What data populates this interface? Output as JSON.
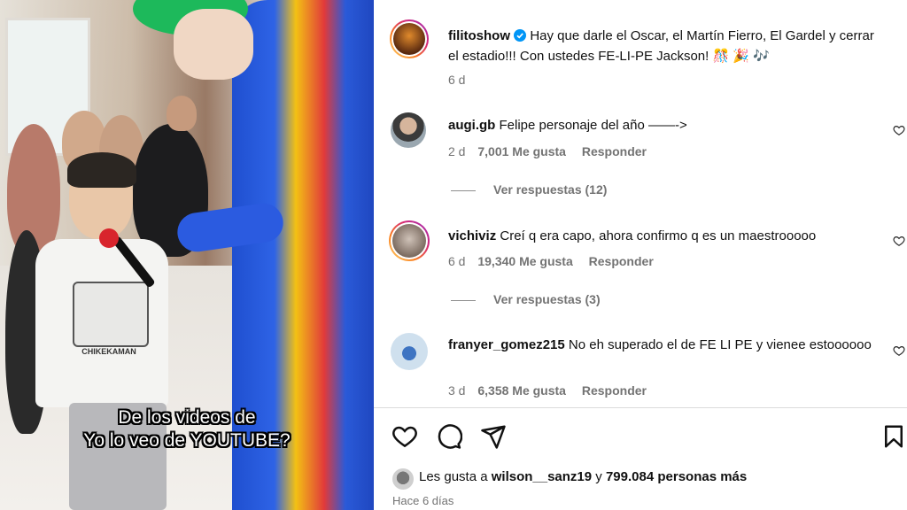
{
  "video": {
    "caption_line1": "De los videos de",
    "caption_line2": "Yo lo veo de YOUTUBE?",
    "shirt_text": "CHIKEKAMAN"
  },
  "post": {
    "username": "filitoshow",
    "verified": true,
    "caption": "Hay que darle el Oscar, el Martín Fierro, El Gardel y cerrar el estadio!!! Con ustedes FE-LI-PE Jackson! 🎊 🎉 🎶",
    "age": "6 d"
  },
  "comments": [
    {
      "username": "augi.gb",
      "text": "Felipe personaje del año ——->",
      "age": "2 d",
      "likes": "7,001 Me gusta",
      "reply": "Responder",
      "view_replies": "Ver respuestas (12)"
    },
    {
      "username": "vichiviz",
      "text": "Creí q era capo, ahora confirmo q es un maestrooooo",
      "age": "6 d",
      "likes": "19,340 Me gusta",
      "reply": "Responder",
      "view_replies": "Ver respuestas (3)"
    },
    {
      "username": "franyer_gomez215",
      "text": "No eh superado el de FE LI PE y vienee estoooooo",
      "age": "3 d",
      "likes": "6,358 Me gusta",
      "reply": "Responder"
    }
  ],
  "likes_line": {
    "prefix": "Les gusta a",
    "user": "wilson__sanz19",
    "middle": "y",
    "count": "799.084 personas más"
  },
  "posted_when": "Hace 6 días",
  "colors": {
    "accent_verified": "#0095f6",
    "muted": "#737373"
  }
}
